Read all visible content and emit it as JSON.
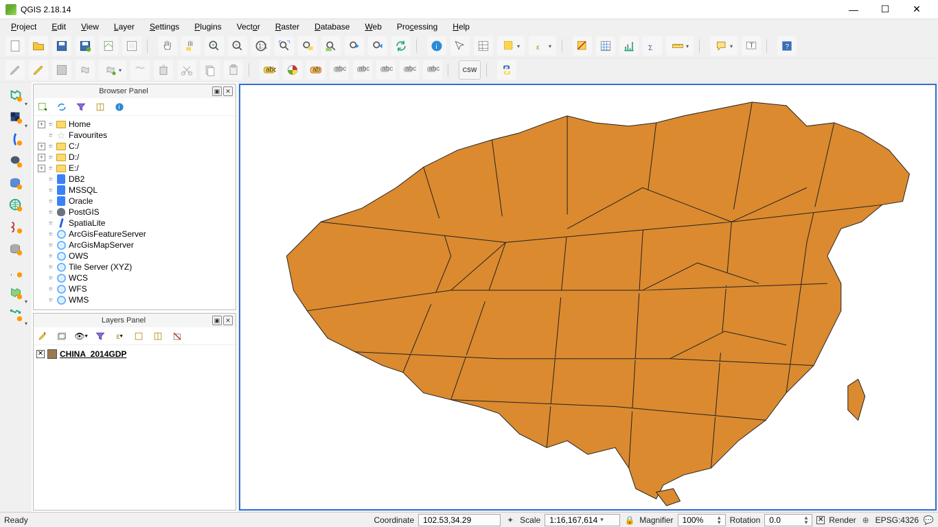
{
  "app": {
    "title": "QGIS 2.18.14"
  },
  "menu": {
    "project": "Project",
    "edit": "Edit",
    "view": "View",
    "layer": "Layer",
    "settings": "Settings",
    "plugins": "Plugins",
    "vector": "Vector",
    "raster": "Raster",
    "database": "Database",
    "web": "Web",
    "processing": "Processing",
    "help": "Help"
  },
  "browser": {
    "title": "Browser Panel",
    "items": [
      {
        "label": "Home",
        "icon": "folder",
        "exp": "+"
      },
      {
        "label": "Favourites",
        "icon": "star",
        "exp": ""
      },
      {
        "label": "C:/",
        "icon": "folder",
        "exp": "+"
      },
      {
        "label": "D:/",
        "icon": "folder",
        "exp": "+"
      },
      {
        "label": "E:/",
        "icon": "folder",
        "exp": "+"
      },
      {
        "label": "DB2",
        "icon": "db",
        "exp": ""
      },
      {
        "label": "MSSQL",
        "icon": "db",
        "exp": ""
      },
      {
        "label": "Oracle",
        "icon": "db",
        "exp": ""
      },
      {
        "label": "PostGIS",
        "icon": "ele",
        "exp": ""
      },
      {
        "label": "SpatiaLite",
        "icon": "feather",
        "exp": ""
      },
      {
        "label": "ArcGisFeatureServer",
        "icon": "globe",
        "exp": ""
      },
      {
        "label": "ArcGisMapServer",
        "icon": "globe",
        "exp": ""
      },
      {
        "label": "OWS",
        "icon": "globe",
        "exp": ""
      },
      {
        "label": "Tile Server (XYZ)",
        "icon": "globe",
        "exp": ""
      },
      {
        "label": "WCS",
        "icon": "globe",
        "exp": ""
      },
      {
        "label": "WFS",
        "icon": "globe",
        "exp": ""
      },
      {
        "label": "WMS",
        "icon": "globe",
        "exp": ""
      }
    ]
  },
  "layers": {
    "title": "Layers Panel",
    "items": [
      {
        "name": "CHINA_2014GDP",
        "checked": true,
        "color": "#9c7a4d"
      }
    ]
  },
  "status": {
    "ready": "Ready",
    "coord_label": "Coordinate",
    "coord": "102.53,34.29",
    "scale_label": "Scale",
    "scale": "1:16,167,614",
    "magnifier_label": "Magnifier",
    "magnifier": "100%",
    "rotation_label": "Rotation",
    "rotation": "0.0",
    "render": "Render",
    "crs": "EPSG:4326"
  },
  "csw": "CSW"
}
